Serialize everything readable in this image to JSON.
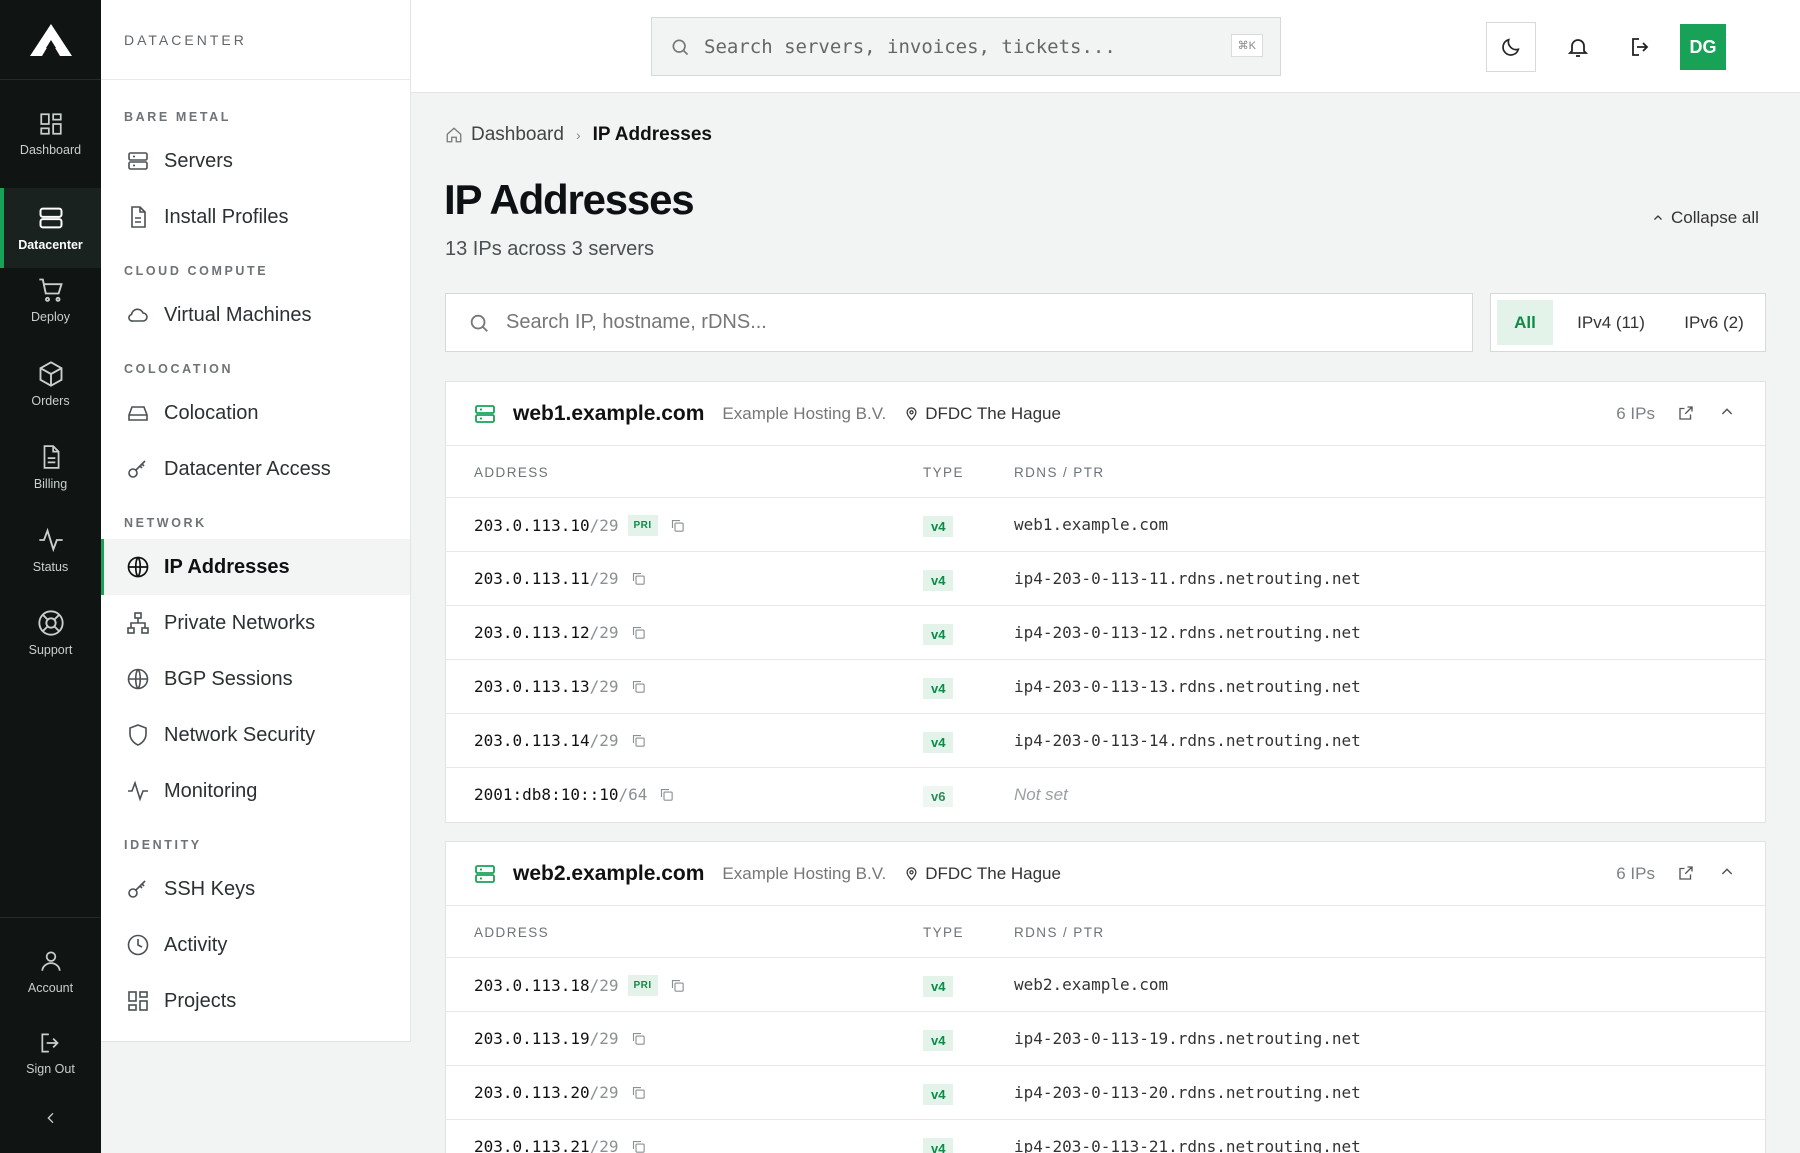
{
  "rail": {
    "items": [
      {
        "label": "Dashboard",
        "icon": "dashboard-grid-icon"
      },
      {
        "label": "Datacenter",
        "icon": "server-stack-icon",
        "active": true
      },
      {
        "label": "Deploy",
        "icon": "cart-icon"
      },
      {
        "label": "Orders",
        "icon": "box-icon"
      },
      {
        "label": "Billing",
        "icon": "document-icon"
      },
      {
        "label": "Status",
        "icon": "pulse-icon"
      },
      {
        "label": "Support",
        "icon": "lifebuoy-icon"
      }
    ],
    "bottom": [
      {
        "label": "Account",
        "icon": "user-icon"
      },
      {
        "label": "Sign Out",
        "icon": "sign-out-icon"
      }
    ]
  },
  "sidebar": {
    "title": "DATACENTER",
    "sections": {
      "bare_metal": "BARE METAL",
      "cloud_compute": "CLOUD COMPUTE",
      "colocation": "COLOCATION",
      "network": "NETWORK",
      "identity": "IDENTITY"
    },
    "items": {
      "servers": "Servers",
      "install_profiles": "Install Profiles",
      "virtual_machines": "Virtual Machines",
      "colocation": "Colocation",
      "datacenter_access": "Datacenter Access",
      "ip_addresses": "IP Addresses",
      "private_networks": "Private Networks",
      "bgp_sessions": "BGP Sessions",
      "network_security": "Network Security",
      "monitoring": "Monitoring",
      "ssh_keys": "SSH Keys",
      "activity": "Activity",
      "projects": "Projects"
    }
  },
  "topbar": {
    "search_placeholder": "Search servers, invoices, tickets...",
    "shortcut": "⌘K",
    "avatar_initials": "DG"
  },
  "page": {
    "breadcrumb_home": "Dashboard",
    "breadcrumb_current": "IP Addresses",
    "title": "IP Addresses",
    "subtitle": "13 IPs across 3 servers",
    "collapse_all": "Collapse all",
    "ip_search_placeholder": "Search IP, hostname, rDNS...",
    "filters": {
      "all": "All",
      "ipv4": "IPv4 (11)",
      "ipv6": "IPv6 (2)"
    }
  },
  "table_headers": {
    "address": "ADDRESS",
    "type": "TYPE",
    "rdns": "RDNS / PTR"
  },
  "servers": [
    {
      "hostname": "web1.example.com",
      "provider": "Example Hosting B.V.",
      "location": "DFDC The Hague",
      "count": "6 IPs",
      "rows": [
        {
          "ip": "203.0.113.10",
          "prefix": "/29",
          "pri": "PRI",
          "type": "v4",
          "rdns": "web1.example.com"
        },
        {
          "ip": "203.0.113.11",
          "prefix": "/29",
          "type": "v4",
          "rdns": "ip4-203-0-113-11.rdns.netrouting.net"
        },
        {
          "ip": "203.0.113.12",
          "prefix": "/29",
          "type": "v4",
          "rdns": "ip4-203-0-113-12.rdns.netrouting.net"
        },
        {
          "ip": "203.0.113.13",
          "prefix": "/29",
          "type": "v4",
          "rdns": "ip4-203-0-113-13.rdns.netrouting.net"
        },
        {
          "ip": "203.0.113.14",
          "prefix": "/29",
          "type": "v4",
          "rdns": "ip4-203-0-113-14.rdns.netrouting.net"
        },
        {
          "ip": "2001:db8:10::10",
          "prefix": "/64",
          "type": "v6",
          "rdns": "Not set"
        }
      ]
    },
    {
      "hostname": "web2.example.com",
      "provider": "Example Hosting B.V.",
      "location": "DFDC The Hague",
      "count": "6 IPs",
      "rows": [
        {
          "ip": "203.0.113.18",
          "prefix": "/29",
          "pri": "PRI",
          "type": "v4",
          "rdns": "web2.example.com"
        },
        {
          "ip": "203.0.113.19",
          "prefix": "/29",
          "type": "v4",
          "rdns": "ip4-203-0-113-19.rdns.netrouting.net"
        },
        {
          "ip": "203.0.113.20",
          "prefix": "/29",
          "type": "v4",
          "rdns": "ip4-203-0-113-20.rdns.netrouting.net"
        },
        {
          "ip": "203.0.113.21",
          "prefix": "/29",
          "type": "v4",
          "rdns": "ip4-203-0-113-21.rdns.netrouting.net"
        }
      ]
    }
  ]
}
